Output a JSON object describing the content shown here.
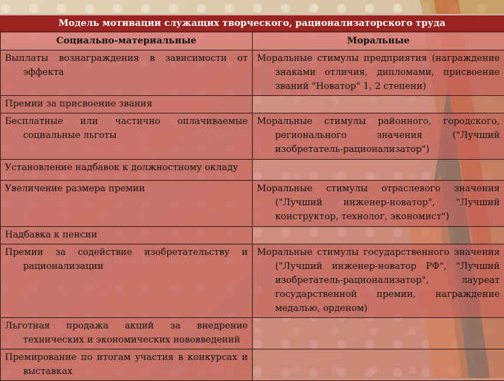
{
  "table": {
    "title": "Модель мотивации служащих творческого, рационализаторского труда",
    "headers": [
      "Социально-материальные",
      "Моральные"
    ],
    "rows": [
      {
        "left": "Выплаты вознаграждения в зависимости от эффекта",
        "right": "Моральные стимулы предприятия (награждение знаками отличия, дипломами, присвоение званий \"Новатор\" 1, 2 степени)"
      },
      {
        "left": "Премии за присвоение звания",
        "right": ""
      },
      {
        "left": "Бесплатные или частично оплачиваемые социальные льготы",
        "right": "Моральные стимулы районного, городского, регионального значения (\"Лучший изобретатель-рационализатор\")"
      },
      {
        "left": "Установление надбавок к должностному окладу",
        "right": ""
      },
      {
        "left": "Увеличение размера премии",
        "right": "Моральные стимулы отраслевого значения (\"Лучший инженер-новатор\", \"Лучший конструктор, технолог, экономист\")"
      },
      {
        "left": "Надбавка к пенсии",
        "right": ""
      },
      {
        "left": "Премии за содействие изобретательству и рационализации",
        "right": "Моральные стимулы государственного значения (\"Лучший инженер-новатор РФ\", \"Лучший изобретатель-рационализатор\", лауреат государственной премии, награждение медалью, орденом)"
      },
      {
        "left": "Льготная продажа акций за внедрение технических и экономических нововведений",
        "right": ""
      },
      {
        "left": "Премирование по итогам участия в конкурсах и выставках",
        "right": ""
      }
    ]
  },
  "colors": {
    "title_bar": "#9a2220",
    "cell_fill": "#c4605c",
    "border": "#3a1b1b",
    "background": "#d9c7a8"
  }
}
